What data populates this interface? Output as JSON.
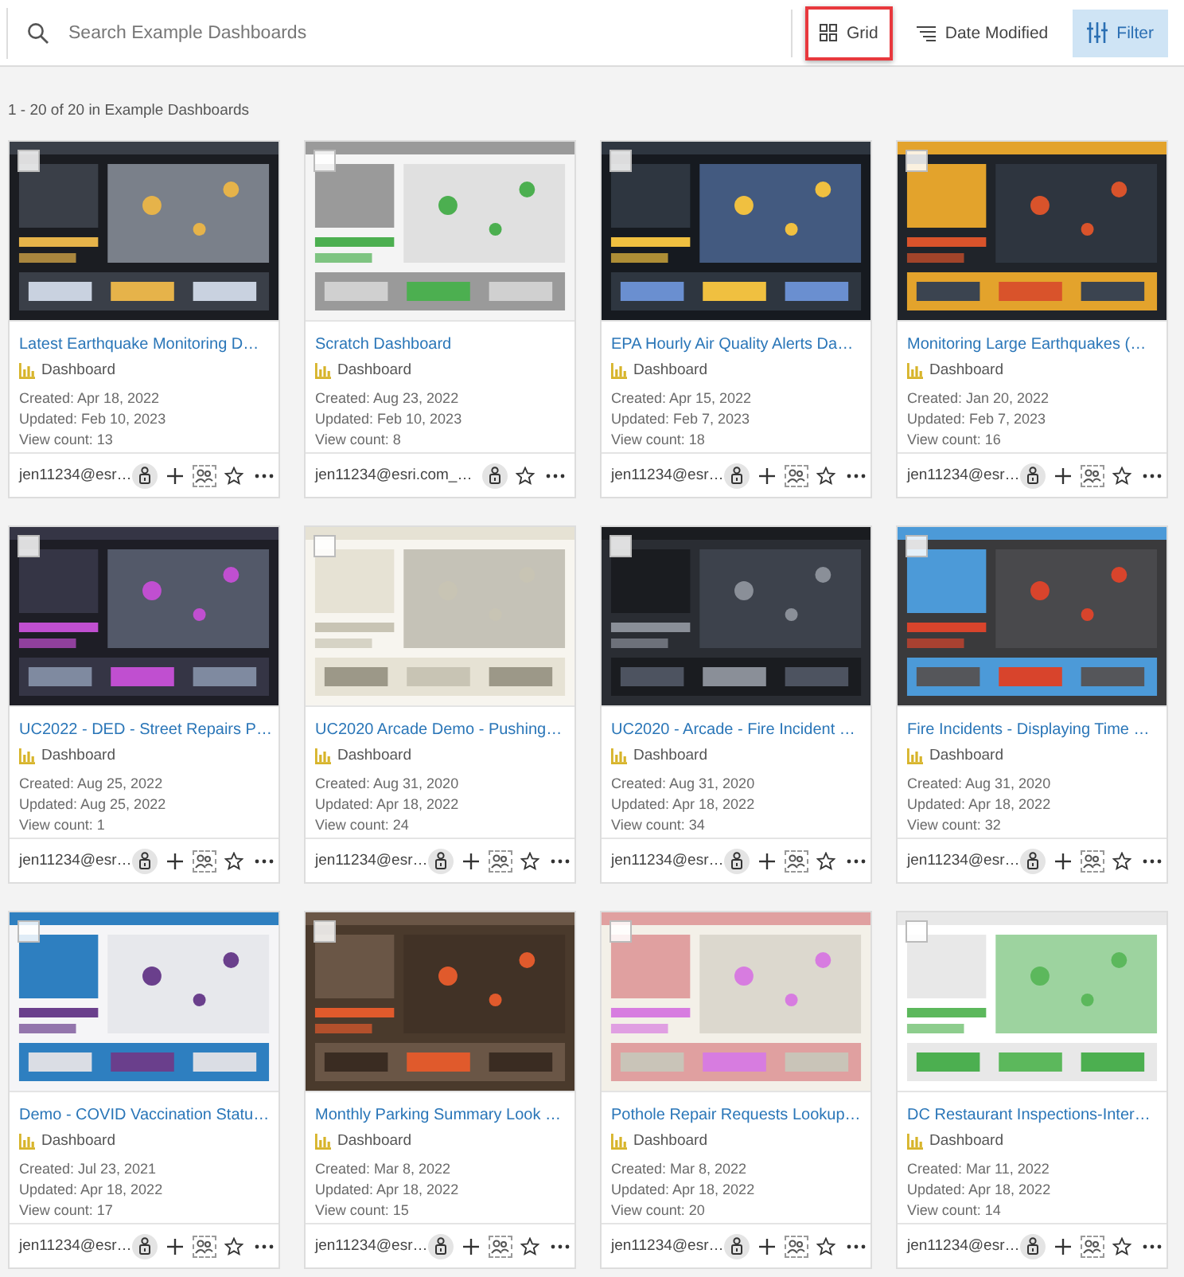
{
  "toolbar": {
    "search": {
      "placeholder": "Search Example Dashboards"
    },
    "buttons": [
      {
        "kind": "grid",
        "label": "Grid",
        "highlighted": true,
        "selected": false
      },
      {
        "kind": "sort",
        "label": "Date Modified",
        "highlighted": false,
        "selected": false
      },
      {
        "kind": "filter",
        "label": "Filter",
        "highlighted": false,
        "selected": true
      }
    ]
  },
  "result_count": "1 - 20 of 20 in Example Dashboards",
  "cards": [
    {
      "title": "Latest Earthquake Monitoring D…",
      "type": "Dashboard",
      "created": "Created: Apr 18, 2022",
      "updated": "Updated: Feb 10, 2023",
      "views": "View count: 13",
      "owner": "jen11234@esr…",
      "group_actions": true,
      "checked": false
    },
    {
      "title": "Scratch Dashboard",
      "type": "Dashboard",
      "created": "Created: Aug 23, 2022",
      "updated": "Updated: Feb 10, 2023",
      "views": "View count: 8",
      "owner": "jen11234@esri.com_…",
      "group_actions": false,
      "checked": false
    },
    {
      "title": "EPA Hourly Air Quality Alerts Da…",
      "type": "Dashboard",
      "created": "Created: Apr 15, 2022",
      "updated": "Updated: Feb 7, 2023",
      "views": "View count: 18",
      "owner": "jen11234@esr…",
      "group_actions": true,
      "checked": false
    },
    {
      "title": "Monitoring Large Earthquakes (…",
      "type": "Dashboard",
      "created": "Created: Jan 20, 2022",
      "updated": "Updated: Feb 7, 2023",
      "views": "View count: 16",
      "owner": "jen11234@esr…",
      "group_actions": true,
      "checked": false
    },
    {
      "title": "UC2022 - DED - Street Repairs P…",
      "type": "Dashboard",
      "created": "Created: Aug 25, 2022",
      "updated": "Updated: Aug 25, 2022",
      "views": "View count: 1",
      "owner": "jen11234@esr…",
      "group_actions": true,
      "checked": false
    },
    {
      "title": "UC2020 Arcade Demo - Pushing…",
      "type": "Dashboard",
      "created": "Created: Aug 31, 2020",
      "updated": "Updated: Apr 18, 2022",
      "views": "View count: 24",
      "owner": "jen11234@esr…",
      "group_actions": true,
      "checked": false
    },
    {
      "title": "UC2020 - Arcade - Fire Incident …",
      "type": "Dashboard",
      "created": "Created: Aug 31, 2020",
      "updated": "Updated: Apr 18, 2022",
      "views": "View count: 34",
      "owner": "jen11234@esr…",
      "group_actions": true,
      "checked": false
    },
    {
      "title": "Fire Incidents - Displaying Time …",
      "type": "Dashboard",
      "created": "Created: Aug 31, 2020",
      "updated": "Updated: Apr 18, 2022",
      "views": "View count: 32",
      "owner": "jen11234@esr…",
      "group_actions": true,
      "checked": false
    },
    {
      "title": "Demo - COVID Vaccination Statu…",
      "type": "Dashboard",
      "created": "Created: Jul 23, 2021",
      "updated": "Updated: Apr 18, 2022",
      "views": "View count: 17",
      "owner": "jen11234@esr…",
      "group_actions": true,
      "checked": false
    },
    {
      "title": "Monthly Parking Summary Look …",
      "type": "Dashboard",
      "created": "Created: Mar 8, 2022",
      "updated": "Updated: Apr 18, 2022",
      "views": "View count: 15",
      "owner": "jen11234@esr…",
      "group_actions": true,
      "checked": false
    },
    {
      "title": "Pothole Repair Requests Lookup…",
      "type": "Dashboard",
      "created": "Created: Mar 8, 2022",
      "updated": "Updated: Apr 18, 2022",
      "views": "View count: 20",
      "owner": "jen11234@esr…",
      "group_actions": true,
      "checked": false
    },
    {
      "title": "DC Restaurant Inspections-Inter…",
      "type": "Dashboard",
      "created": "Created: Mar 11, 2022",
      "updated": "Updated: Apr 18, 2022",
      "views": "View count: 14",
      "owner": "jen11234@esr…",
      "group_actions": true,
      "checked": false
    }
  ]
}
